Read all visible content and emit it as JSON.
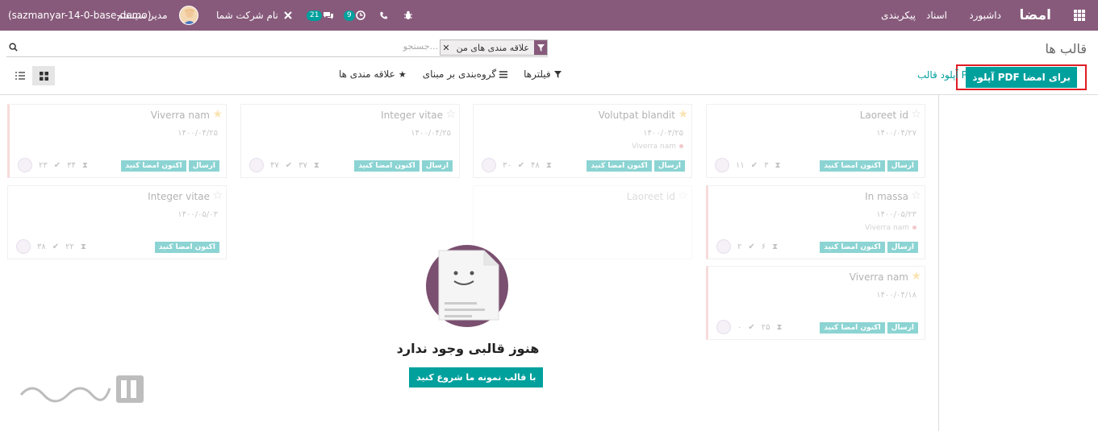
{
  "navbar": {
    "brand": "امضا",
    "menu": [
      "داشبورد",
      "اسناد",
      "پیکربندی"
    ],
    "company": "نام شرکت شما",
    "user": "مدیر سیستم",
    "database": "(sazmanyar-14-0-base-demo)",
    "messages_badge": "21",
    "activity_badge": "9"
  },
  "breadcrumb": "قالب ها",
  "search": {
    "placeholder": "جستجو...",
    "facet": "علاقه مندی های من"
  },
  "buttons": {
    "upload_pdf_sign": "آپلود PDF برای امضا",
    "upload_template": "آپلود قالب PDF",
    "filters": "فیلترها",
    "group_by": "گروه‌بندی بر مبنای",
    "favorites": "علاقه مندی ها"
  },
  "cards": [
    {
      "title": "Laoreet id",
      "date": "۱۴۰۰/۰۴/۲۷",
      "tag": "",
      "starred": false,
      "stats": [
        "۳",
        "۱۱"
      ],
      "send": "ارسال",
      "sign_now": "اکنون امضا کنید"
    },
    {
      "title": "Volutpat blandit",
      "date": "۱۴۰۰/۰۳/۲۵",
      "tag": "Viverra nam",
      "starred": true,
      "stats": [
        "۴۸",
        "۳۰"
      ],
      "send": "ارسال",
      "sign_now": "اکنون امضا کنید"
    },
    {
      "title": "Integer vitae",
      "date": "۱۴۰۰/۰۴/۲۵",
      "tag": "",
      "starred": false,
      "stats": [
        "۳۷",
        "۴۷"
      ],
      "send": "ارسال",
      "sign_now": "اکنون امضا کنید"
    },
    {
      "title": "Viverra nam",
      "date": "۱۴۰۰/۰۴/۲۵",
      "tag": "",
      "starred": true,
      "stats": [
        "۳۴",
        "۲۳"
      ],
      "send": "ارسال",
      "sign_now": "اکنون امضا کنید"
    },
    {
      "title": "In massa",
      "date": "۱۴۰۰/۰۵/۲۳",
      "tag": "Viverra nam",
      "starred": false,
      "stats": [
        "۶",
        "۲"
      ],
      "send": "ارسال",
      "sign_now": "اکنون امضا کنید"
    },
    {
      "title": "Laoreet id",
      "date": "",
      "tag": "",
      "starred": false,
      "stats": [],
      "send": "",
      "sign_now": ""
    },
    {
      "title": "Integer vitae",
      "date": "۱۴۰۰/۰۵/۰۳",
      "tag": "",
      "starred": false,
      "stats": [
        "۲۲",
        "۳۸"
      ],
      "send": "",
      "sign_now": "اکنون امضا کنید"
    },
    {
      "title": "Viverra nam",
      "date": "۱۴۰۰/۰۴/۱۸",
      "tag": "",
      "starred": true,
      "stats": [
        "۲۵",
        "۰"
      ],
      "send": "ارسال",
      "sign_now": "اکنون امضا کنید"
    }
  ],
  "empty": {
    "title": "هنوز قالبی وجود ندارد",
    "button": "با قالب نمونه ما شروع کنید"
  },
  "colors": {
    "primary": "#875a7b",
    "accent": "#00a09d",
    "highlight": "#e01b24"
  }
}
